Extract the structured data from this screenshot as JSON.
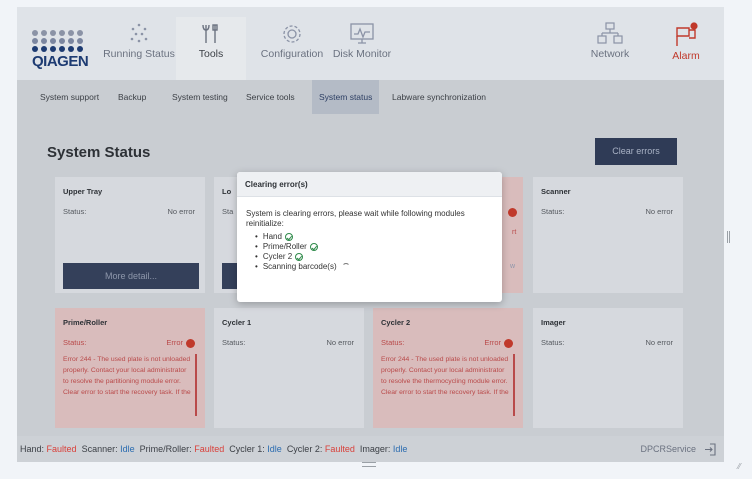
{
  "header": {
    "logo_text": "QIAGEN",
    "nav": [
      {
        "label": "Running Status",
        "icon": "dots-cluster-icon"
      },
      {
        "label": "Tools",
        "icon": "tools-icon"
      },
      {
        "label": "Configuration",
        "icon": "gear-icon"
      },
      {
        "label": "Disk Monitor",
        "icon": "monitor-icon"
      },
      {
        "label": "Network",
        "icon": "network-icon"
      },
      {
        "label": "Alarm",
        "icon": "alarm-flag-icon"
      }
    ],
    "alarm_badge": "!"
  },
  "subnav": {
    "tabs": [
      "System support",
      "Backup",
      "System testing",
      "Service tools",
      "System status",
      "Labware synchronization"
    ],
    "active": "System status"
  },
  "main": {
    "title": "System Status",
    "clear_button": "Clear errors",
    "status_label": "Status:",
    "more_details": "More detail...",
    "cards": [
      {
        "title": "Upper Tray",
        "status": "No error"
      },
      {
        "title": "Lo",
        "status_prefix": "Sta"
      },
      {
        "title": "",
        "status": ""
      },
      {
        "title": "Scanner",
        "status": "No error"
      },
      {
        "title": "Prime/Roller",
        "status": "Error",
        "error_text": "Error 244 - The used plate is not unloaded properly. Contact your local administrator to resolve the partitioning module error. Clear error to start the recovery task. If the"
      },
      {
        "title": "Cycler 1",
        "status": "No error"
      },
      {
        "title": "Cycler 2",
        "status": "Error",
        "error_text": "Error 244 - The used plate is not unloaded properly. Contact your local administrator to resolve the thermocycling module error. Clear error to start the recovery task. If the"
      },
      {
        "title": "Imager",
        "status": "No error"
      }
    ],
    "partial_right_text": [
      "rt",
      "w"
    ]
  },
  "statusbar": {
    "items": [
      {
        "key": "Hand:",
        "value": "Faulted",
        "state": "bad"
      },
      {
        "key": "Scanner:",
        "value": "Idle",
        "state": "ok"
      },
      {
        "key": "Prime/Roller:",
        "value": "Faulted",
        "state": "bad"
      },
      {
        "key": "Cycler 1:",
        "value": "Idle",
        "state": "ok"
      },
      {
        "key": "Cycler 2:",
        "value": "Faulted",
        "state": "bad"
      },
      {
        "key": "Imager:",
        "value": "Idle",
        "state": "ok"
      }
    ],
    "user": "DPCRService"
  },
  "dialog": {
    "title": "Clearing error(s)",
    "message": "System is clearing errors, please wait while following modules reinitialize:",
    "modules": [
      {
        "name": "Hand",
        "state": "done"
      },
      {
        "name": "Prime/Roller",
        "state": "done"
      },
      {
        "name": "Cycler 2",
        "state": "done"
      },
      {
        "name": "Scanning barcode(s)",
        "state": "in-progress"
      }
    ]
  },
  "colors": {
    "accent": "#2f3b56",
    "error": "#c0392b",
    "link": "#2b6cb0",
    "success": "#2f8a4a"
  }
}
